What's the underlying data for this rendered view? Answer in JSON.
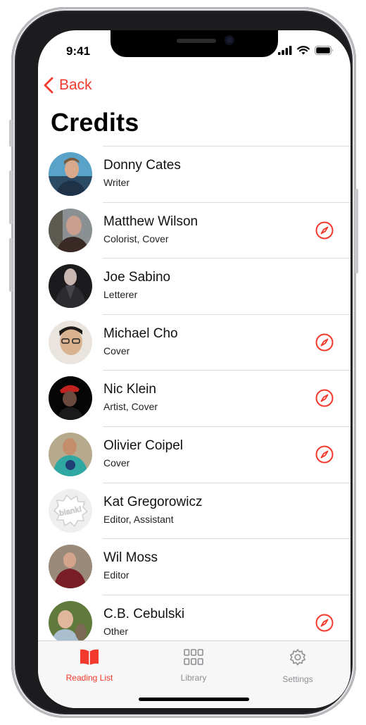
{
  "status_bar": {
    "time": "9:41"
  },
  "nav": {
    "back_label": "Back",
    "title": "Credits"
  },
  "accent_color": "#f2392b",
  "credits": [
    {
      "name": "Donny Cates",
      "role": "Writer",
      "has_link": false
    },
    {
      "name": "Matthew Wilson",
      "role": "Colorist, Cover",
      "has_link": true
    },
    {
      "name": "Joe Sabino",
      "role": "Letterer",
      "has_link": false
    },
    {
      "name": "Michael Cho",
      "role": "Cover",
      "has_link": true
    },
    {
      "name": "Nic Klein",
      "role": "Artist, Cover",
      "has_link": true
    },
    {
      "name": "Olivier Coipel",
      "role": "Cover",
      "has_link": true
    },
    {
      "name": "Kat Gregorowicz",
      "role": "Editor, Assistant",
      "has_link": false
    },
    {
      "name": "Wil Moss",
      "role": "Editor",
      "has_link": false
    },
    {
      "name": "C.B. Cebulski",
      "role": "Other",
      "has_link": true
    }
  ],
  "placeholder_avatar_text": "blank!",
  "tabs": [
    {
      "label": "Reading List",
      "icon": "book-icon",
      "selected": true
    },
    {
      "label": "Library",
      "icon": "grid-icon",
      "selected": false
    },
    {
      "label": "Settings",
      "icon": "gear-icon",
      "selected": false
    }
  ]
}
